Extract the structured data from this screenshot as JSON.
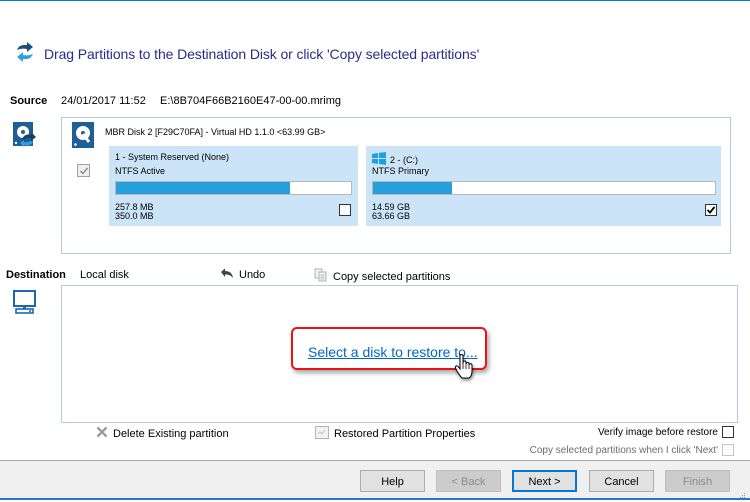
{
  "header": {
    "title": "Drag Partitions to the Destination Disk or click 'Copy selected partitions'",
    "icon": "swap-arrows-icon"
  },
  "source": {
    "label": "Source",
    "date": "24/01/2017 11:52",
    "path": "E:\\8B704F66B2160E47-00-00.mrimg",
    "disk": {
      "title": "MBR Disk 2 [F29C70FA] - Virtual HD 1.1.0  <63.99 GB>",
      "checked": true,
      "partitions": [
        {
          "name": "1 - System Reserved (None)",
          "filesystem": "NTFS Active",
          "used": "257.8 MB",
          "total": "350.0 MB",
          "usage_fraction": 0.74,
          "checked": false
        },
        {
          "name": "2 -  (C:)",
          "filesystem": "NTFS Primary",
          "used": "14.59 GB",
          "total": "63.66 GB",
          "usage_fraction": 0.23,
          "checked": true,
          "icon": "windows-logo-icon"
        }
      ]
    }
  },
  "destination": {
    "label": "Destination",
    "type": "Local disk",
    "undo_label": "Undo",
    "copy_selected_label": "Copy selected partitions",
    "select_link": "Select a disk to restore to..."
  },
  "options": {
    "delete_partition": "Delete Existing partition",
    "restored_properties": "Restored Partition Properties",
    "verify_label": "Verify image before restore",
    "verify_checked": false,
    "copy_next_label": "Copy selected partitions when I click 'Next'",
    "copy_next_checked": false
  },
  "footer": {
    "help": "Help",
    "back": "< Back",
    "next": "Next >",
    "cancel": "Cancel",
    "finish": "Finish"
  },
  "colors": {
    "accent": "#0078d7",
    "partition_bg": "#cce4f7",
    "bar_fill": "#26a0da",
    "highlight_border": "#e8131b",
    "link": "#0066cc"
  }
}
